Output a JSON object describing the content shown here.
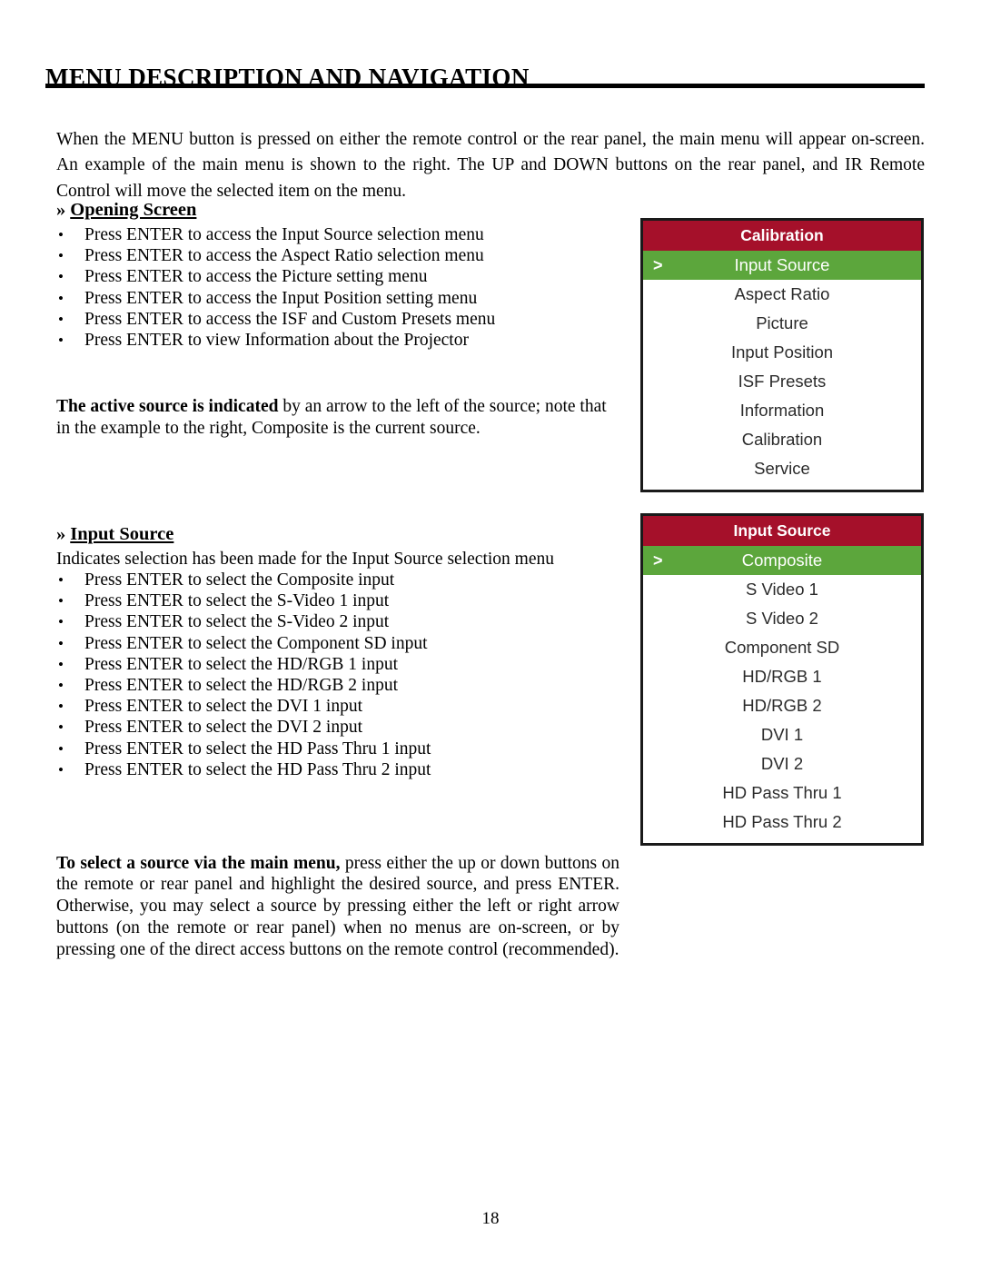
{
  "page": {
    "title": "MENU DESCRIPTION AND NAVIGATION",
    "number": "18",
    "intro": "When the MENU button is pressed on either the remote control or the rear panel, the main menu will appear on-screen. An example of the main menu is shown to the right. The UP and DOWN buttons on the rear panel, and IR Remote Control will move the selected item on the menu."
  },
  "sections": {
    "opening_screen": {
      "guillemet": "»",
      "heading": "Opening Screen",
      "bullets": [
        "Press ENTER to access the Input Source selection menu",
        "Press ENTER to access the Aspect Ratio selection menu",
        "Press ENTER to access the Picture setting menu",
        "Press ENTER to access the Input Position setting menu",
        "Press ENTER to access the ISF and Custom Presets menu",
        "Press ENTER to view Information about the Projector"
      ],
      "note_bold": "The active source is indicated",
      "note_rest": " by an arrow to the left of the source; note that in the example to the right, Composite is the current source."
    },
    "input_source": {
      "guillemet": "»",
      "heading": "Input Source",
      "lead": "Indicates selection has been made for the Input Source selection menu",
      "bullets": [
        "Press ENTER to select the Composite input",
        "Press ENTER to select the S-Video 1 input",
        "Press ENTER to select the S-Video 2 input",
        "Press ENTER to select the Component SD input",
        "Press ENTER to select the HD/RGB 1 input",
        "Press ENTER to select the HD/RGB 2 input",
        "Press ENTER to select the DVI 1 input",
        "Press ENTER to select the DVI 2 input",
        "Press ENTER to select the HD Pass Thru 1 input",
        "Press ENTER to select the HD Pass Thru 2 input"
      ],
      "closing_bold": "To select a source via the main menu,",
      "closing_rest": " press either the up or down buttons on the remote or rear panel and highlight the desired source, and press ENTER. Otherwise, you may select a source by pressing either the left or right arrow buttons (on the remote or rear panel) when no menus are on-screen, or by pressing one of the direct access buttons on the remote control (recommended)."
    }
  },
  "bullet_glyph": "•",
  "osd": {
    "colors": {
      "header_bg": "#a5102a",
      "selected_bg": "#5ca63c",
      "header_text": "#ffffff",
      "selected_text": "#ffffff",
      "item_text": "#2b2b2b",
      "border": "#1a1a1a",
      "panel_bg": "#ffffff"
    },
    "arrow_glyph": ">",
    "main_menu": {
      "title": "Calibration",
      "items": [
        {
          "label": "Input Source",
          "selected": true
        },
        {
          "label": "Aspect Ratio",
          "selected": false
        },
        {
          "label": "Picture",
          "selected": false
        },
        {
          "label": "Input Position",
          "selected": false
        },
        {
          "label": "ISF Presets",
          "selected": false
        },
        {
          "label": "Information",
          "selected": false
        },
        {
          "label": "Calibration",
          "selected": false
        },
        {
          "label": "Service",
          "selected": false
        }
      ]
    },
    "input_menu": {
      "title": "Input Source",
      "items": [
        {
          "label": "Composite",
          "selected": true
        },
        {
          "label": "S Video 1",
          "selected": false
        },
        {
          "label": "S Video 2",
          "selected": false
        },
        {
          "label": "Component  SD",
          "selected": false
        },
        {
          "label": "HD/RGB 1",
          "selected": false
        },
        {
          "label": "HD/RGB 2",
          "selected": false
        },
        {
          "label": "DVI 1",
          "selected": false
        },
        {
          "label": "DVI 2",
          "selected": false
        },
        {
          "label": "HD Pass Thru 1",
          "selected": false
        },
        {
          "label": "HD Pass Thru 2",
          "selected": false
        }
      ]
    }
  }
}
